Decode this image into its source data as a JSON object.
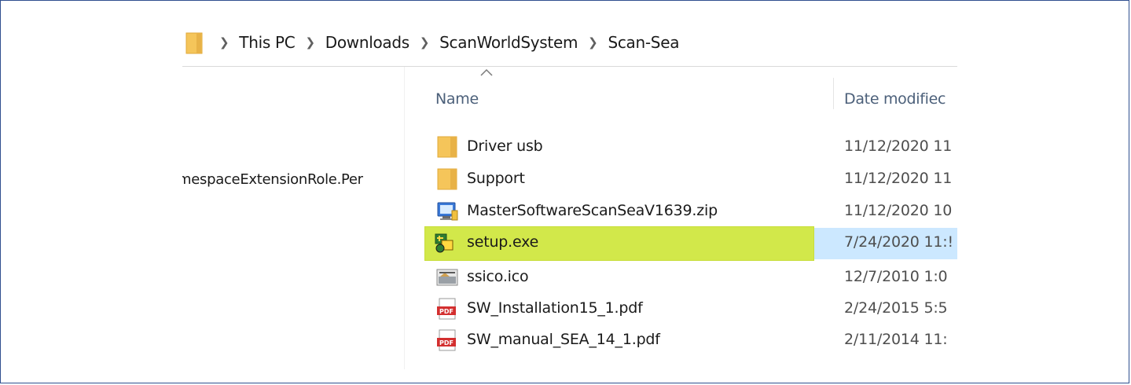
{
  "breadcrumb": [
    "This PC",
    "Downloads",
    "ScanWorldSystem",
    "Scan-Sea"
  ],
  "nav": {
    "rows": [
      ";",
      "mespaceExtensionRole.Per"
    ]
  },
  "columns": {
    "name": "Name",
    "date": "Date modifiec"
  },
  "files": [
    {
      "name": "Driver usb",
      "date": "11/12/2020 11",
      "icon": "folder-icon",
      "state": "normal"
    },
    {
      "name": "Support",
      "date": "11/12/2020 11",
      "icon": "folder-icon",
      "state": "normal"
    },
    {
      "name": "MasterSoftwareScanSeaV1639.zip",
      "date": "11/12/2020 10",
      "icon": "zip-icon",
      "state": "normal"
    },
    {
      "name": "setup.exe",
      "date": "7/24/2020 11:!",
      "icon": "setup-exe-icon",
      "state": "selected-highlighted"
    },
    {
      "name": "ssico.ico",
      "date": "12/7/2010 1:0",
      "icon": "image-file-icon",
      "state": "normal"
    },
    {
      "name": "SW_Installation15_1.pdf",
      "date": "2/24/2015 5:5",
      "icon": "pdf-icon",
      "state": "normal"
    },
    {
      "name": "SW_manual_SEA_14_1.pdf",
      "date": "2/11/2014 11:",
      "icon": "pdf-icon",
      "state": "normal"
    }
  ],
  "colors": {
    "highlight": "#d2e84a",
    "selection": "#cce8ff",
    "folder": "#f5c55a",
    "frame_border": "#2f4f8f"
  }
}
